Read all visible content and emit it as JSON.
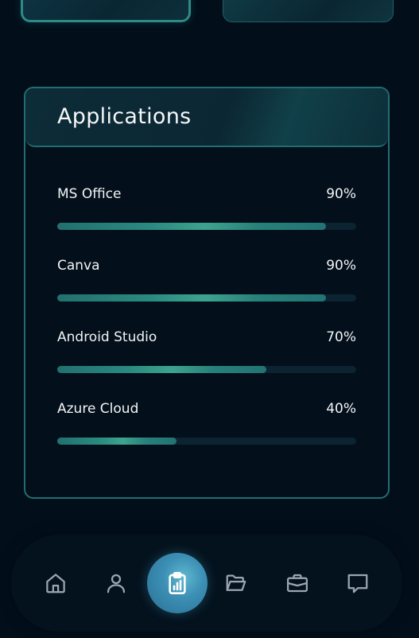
{
  "applications": {
    "title": "Applications",
    "items": [
      {
        "name": "MS Office",
        "percent_label": "90%",
        "level": 0.9
      },
      {
        "name": "Canva",
        "percent_label": "90%",
        "level": 0.9
      },
      {
        "name": "Android Studio",
        "percent_label": "70%",
        "level": 0.7
      },
      {
        "name": "Azure Cloud",
        "percent_label": "40%",
        "level": 0.4
      }
    ]
  },
  "nav": {
    "items": [
      {
        "icon": "home-icon",
        "active": false
      },
      {
        "icon": "user-icon",
        "active": false
      },
      {
        "icon": "clipboard-chart-icon",
        "active": true
      },
      {
        "icon": "folder-open-icon",
        "active": false
      },
      {
        "icon": "briefcase-icon",
        "active": false
      },
      {
        "icon": "chat-icon",
        "active": false
      }
    ]
  },
  "colors": {
    "background": "#020f1b",
    "accent": "#2d8a86",
    "bar_fill": "#3da38e",
    "active_nav": "#3c8fb4"
  }
}
